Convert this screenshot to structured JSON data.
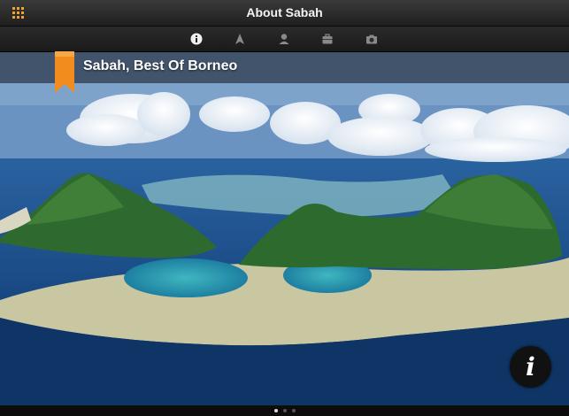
{
  "header": {
    "title": "About Sabah",
    "menu_icon": "grid-icon"
  },
  "tabs": [
    {
      "icon": "info-icon",
      "selected": true
    },
    {
      "icon": "navigation-arrow-icon",
      "selected": false
    },
    {
      "icon": "person-icon",
      "selected": false
    },
    {
      "icon": "briefcase-icon",
      "selected": false
    },
    {
      "icon": "camera-icon",
      "selected": false
    }
  ],
  "slide": {
    "caption": "Sabah, Best Of Borneo",
    "image_description_icon": "tropical-island-photo",
    "info_button_label": "i"
  },
  "pager": {
    "count": 3,
    "active_index": 0
  },
  "colors": {
    "accent": "#f2a12b",
    "bookmark": "#f28c1e",
    "bar_dark": "#1f1f1f"
  }
}
